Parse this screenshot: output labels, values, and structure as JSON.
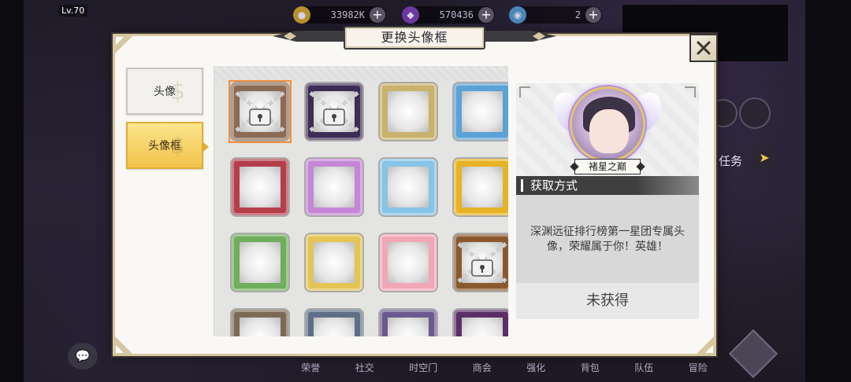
{
  "header": {
    "level": "Lv.70",
    "currencies": [
      {
        "icon": "gold-coin-icon",
        "value": "33982K"
      },
      {
        "icon": "purple-gem-icon",
        "value": "570436"
      },
      {
        "icon": "blue-orb-icon",
        "value": "2"
      }
    ],
    "plus": "+"
  },
  "dialog": {
    "title": "更换头像框",
    "close": "✕",
    "tabs": [
      {
        "label": "头像",
        "selected": false
      },
      {
        "label": "头像框",
        "selected": true
      }
    ]
  },
  "frames": [
    {
      "name": "frame-1",
      "locked": true,
      "selected": true,
      "color": "#8c6a54"
    },
    {
      "name": "frame-2",
      "locked": true,
      "selected": false,
      "color": "#3d2c55"
    },
    {
      "name": "frame-3",
      "locked": false,
      "selected": false,
      "color": "#c9b26b"
    },
    {
      "name": "frame-4",
      "locked": false,
      "selected": false,
      "color": "#5aa1d6"
    },
    {
      "name": "frame-5",
      "locked": false,
      "selected": false,
      "color": "#b53e4a"
    },
    {
      "name": "frame-6",
      "locked": false,
      "selected": false,
      "color": "#c686d6"
    },
    {
      "name": "frame-7",
      "locked": false,
      "selected": false,
      "color": "#87c4e6"
    },
    {
      "name": "frame-8",
      "locked": false,
      "selected": false,
      "color": "#e6b324"
    },
    {
      "name": "frame-9",
      "locked": false,
      "selected": false,
      "color": "#6fae5b"
    },
    {
      "name": "frame-10",
      "locked": false,
      "selected": false,
      "color": "#e4c455"
    },
    {
      "name": "frame-11",
      "locked": false,
      "selected": false,
      "color": "#f1a7b8"
    },
    {
      "name": "frame-12",
      "locked": true,
      "selected": false,
      "color": "#8a5a2e"
    },
    {
      "name": "frame-13",
      "locked": false,
      "selected": false,
      "color": "#7b6a54"
    },
    {
      "name": "frame-14",
      "locked": false,
      "selected": false,
      "color": "#5d6f86"
    },
    {
      "name": "frame-15",
      "locked": false,
      "selected": false,
      "color": "#6a5a8f"
    },
    {
      "name": "frame-16",
      "locked": false,
      "selected": false,
      "color": "#5b2f66"
    }
  ],
  "detail": {
    "frame_name": "褚星之巅",
    "obtain_title": "获取方式",
    "obtain_desc": "深渊远征排行榜第一星团专属头像，荣耀属于你！英雄！",
    "status": "未获得"
  },
  "background": {
    "task_label": "任务",
    "bottom_nav": [
      "荣誉",
      "社交",
      "时空门",
      "商会",
      "强化",
      "背包",
      "队伍",
      "冒险"
    ]
  }
}
